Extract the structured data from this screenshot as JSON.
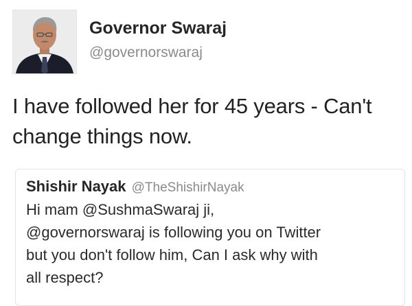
{
  "tweet": {
    "author": {
      "display_name": "Governor Swaraj",
      "handle": "@governorswaraj"
    },
    "text_lines": [
      "I have followed her for 45 years - Can't",
      "change things now."
    ]
  },
  "quoted_tweet": {
    "author": {
      "display_name": "Shishir Nayak",
      "handle": "@TheShishirNayak"
    },
    "text_lines": [
      "Hi mam @SushmaSwaraj ji,",
      "@governorswaraj is following you on Twitter",
      "but you don't follow him, Can I ask why with",
      "all respect?"
    ]
  },
  "colors": {
    "text_primary": "#222222",
    "text_secondary": "#8a8a8a",
    "card_border": "#e3e3e3"
  }
}
